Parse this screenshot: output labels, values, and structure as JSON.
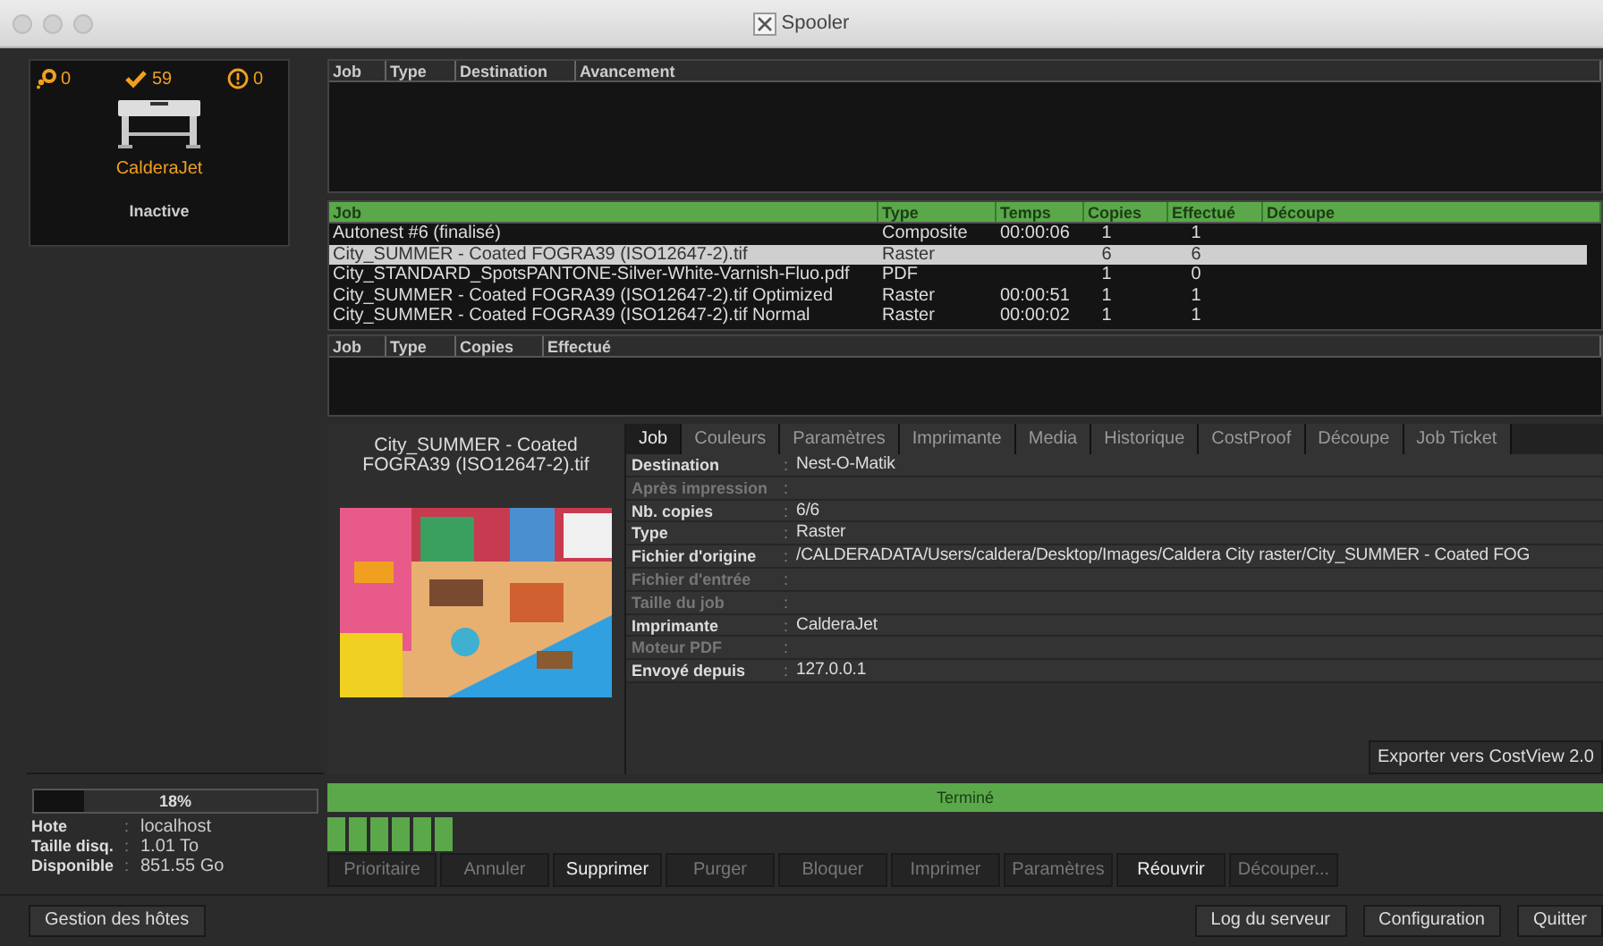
{
  "window": {
    "title": "Spooler"
  },
  "printer": {
    "name": "CalderaJet",
    "status": "Inactive",
    "counters": [
      {
        "kind": "processing",
        "value": "0"
      },
      {
        "kind": "done",
        "value": "59"
      },
      {
        "kind": "error",
        "value": "0"
      }
    ]
  },
  "disk": {
    "level": 0.18,
    "percent": "18%",
    "info": [
      {
        "label": "Hote",
        "value": "localhost"
      },
      {
        "label": "Taille disq.",
        "value": "1.01 To"
      },
      {
        "label": "Disponible",
        "value": "851.55 Go"
      }
    ]
  },
  "queue_table": {
    "columns": [
      "Job",
      "Type",
      "Destination",
      "Avancement"
    ]
  },
  "jobs_table": {
    "columns": [
      "Job",
      "Type",
      "Temps",
      "Copies",
      "Effectué",
      "Découpe"
    ],
    "rows": [
      {
        "cells": [
          "Autonest #6 (finalisé)",
          "Composite",
          "00:00:06",
          "1",
          "1"
        ],
        "selected": false
      },
      {
        "cells": [
          "City_SUMMER - Coated FOGRA39 (ISO12647-2).tif",
          "Raster",
          null,
          "6",
          "6"
        ],
        "selected": true
      },
      {
        "cells": [
          "City_STANDARD_SpotsPANTONE-Silver-White-Varnish-Fluo.pdf",
          "PDF",
          null,
          "1",
          "0"
        ],
        "selected": false
      },
      {
        "cells": [
          "City_SUMMER - Coated FOGRA39 (ISO12647-2).tif Optimized",
          "Raster",
          "00:00:51",
          "1",
          "1"
        ],
        "selected": false
      },
      {
        "cells": [
          "City_SUMMER - Coated FOGRA39 (ISO12647-2).tif Normal",
          "Raster",
          "00:00:02",
          "1",
          "1"
        ],
        "selected": false
      }
    ]
  },
  "pages_table": {
    "columns": [
      "Job",
      "Type",
      "Copies",
      "Effectué"
    ]
  },
  "preview": {
    "title": "City_SUMMER - Coated FOGRA39 (ISO12647-2).tif",
    "kind": "picture"
  },
  "tabs": [
    {
      "label": "Job",
      "selected": true
    },
    {
      "label": "Couleurs",
      "selected": false
    },
    {
      "label": "Paramètres",
      "selected": false
    },
    {
      "label": "Imprimante",
      "selected": false
    },
    {
      "label": "Media",
      "selected": false
    },
    {
      "label": "Historique",
      "selected": false
    },
    {
      "label": "CostProof",
      "selected": false
    },
    {
      "label": "Découpe",
      "selected": false
    },
    {
      "label": "Job Ticket",
      "selected": false
    }
  ],
  "properties": [
    {
      "label": "Destination",
      "value": "Nest-O-Matik",
      "enabled": true
    },
    {
      "label": "Après impression",
      "enabled": false
    },
    {
      "label": "Nb. copies",
      "value": "6/6",
      "enabled": true
    },
    {
      "label": "Type",
      "value": "Raster",
      "enabled": true
    },
    {
      "label": "Fichier d'origine",
      "value": "/CALDERADATA/Users/caldera/Desktop/Images/Caldera City raster/City_SUMMER - Coated FOG",
      "enabled": true
    },
    {
      "label": "Fichier d'entrée",
      "enabled": false
    },
    {
      "label": "Taille du job",
      "enabled": false
    },
    {
      "label": "Imprimante",
      "value": "CalderaJet",
      "enabled": true
    },
    {
      "label": "Moteur PDF",
      "enabled": false
    },
    {
      "label": "Envoyé depuis",
      "value": "127.0.0.1",
      "enabled": true
    }
  ],
  "separator": ":",
  "export_button": "Exporter vers CostView 2.0",
  "job_status": "Terminé",
  "job_progress": {
    "level": 0.1
  },
  "actions": [
    {
      "label": "Prioritaire",
      "enabled": false
    },
    {
      "label": "Annuler",
      "enabled": false
    },
    {
      "label": "Supprimer",
      "enabled": true
    },
    {
      "label": "Purger",
      "enabled": false
    },
    {
      "label": "Bloquer",
      "enabled": false
    },
    {
      "label": "Imprimer",
      "enabled": false
    },
    {
      "label": "Paramètres",
      "enabled": false
    },
    {
      "label": "Réouvrir",
      "enabled": true
    },
    {
      "label": "Découper...",
      "enabled": false
    }
  ],
  "footer": {
    "left": [
      "Gestion des hôtes"
    ],
    "right": [
      "Log du serveur",
      "Configuration",
      "Quitter"
    ]
  }
}
